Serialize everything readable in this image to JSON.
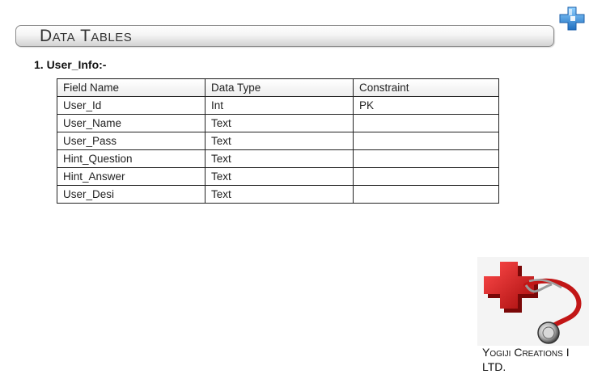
{
  "page": {
    "title": "Data Tables",
    "section_heading": "1. User_Info:-"
  },
  "table": {
    "headers": [
      "Field Name",
      "Data Type",
      "Constraint"
    ],
    "rows": [
      [
        "User_Id",
        "Int",
        "PK"
      ],
      [
        "User_Name",
        "Text",
        ""
      ],
      [
        "User_Pass",
        "Text",
        ""
      ],
      [
        "Hint_Question",
        "Text",
        ""
      ],
      [
        "Hint_Answer",
        "Text",
        ""
      ],
      [
        "User_Desi",
        "Text",
        ""
      ]
    ]
  },
  "footer": {
    "line1": "Yogiji Creations I",
    "line2": "LTD."
  },
  "icons": {
    "corner": "medical-cross-icon",
    "photo": "stethoscope-cross-image"
  },
  "colors": {
    "cross_blue": "#3b8fd6",
    "cross_red": "#d81f1f",
    "title_border": "#8a8a8a"
  }
}
